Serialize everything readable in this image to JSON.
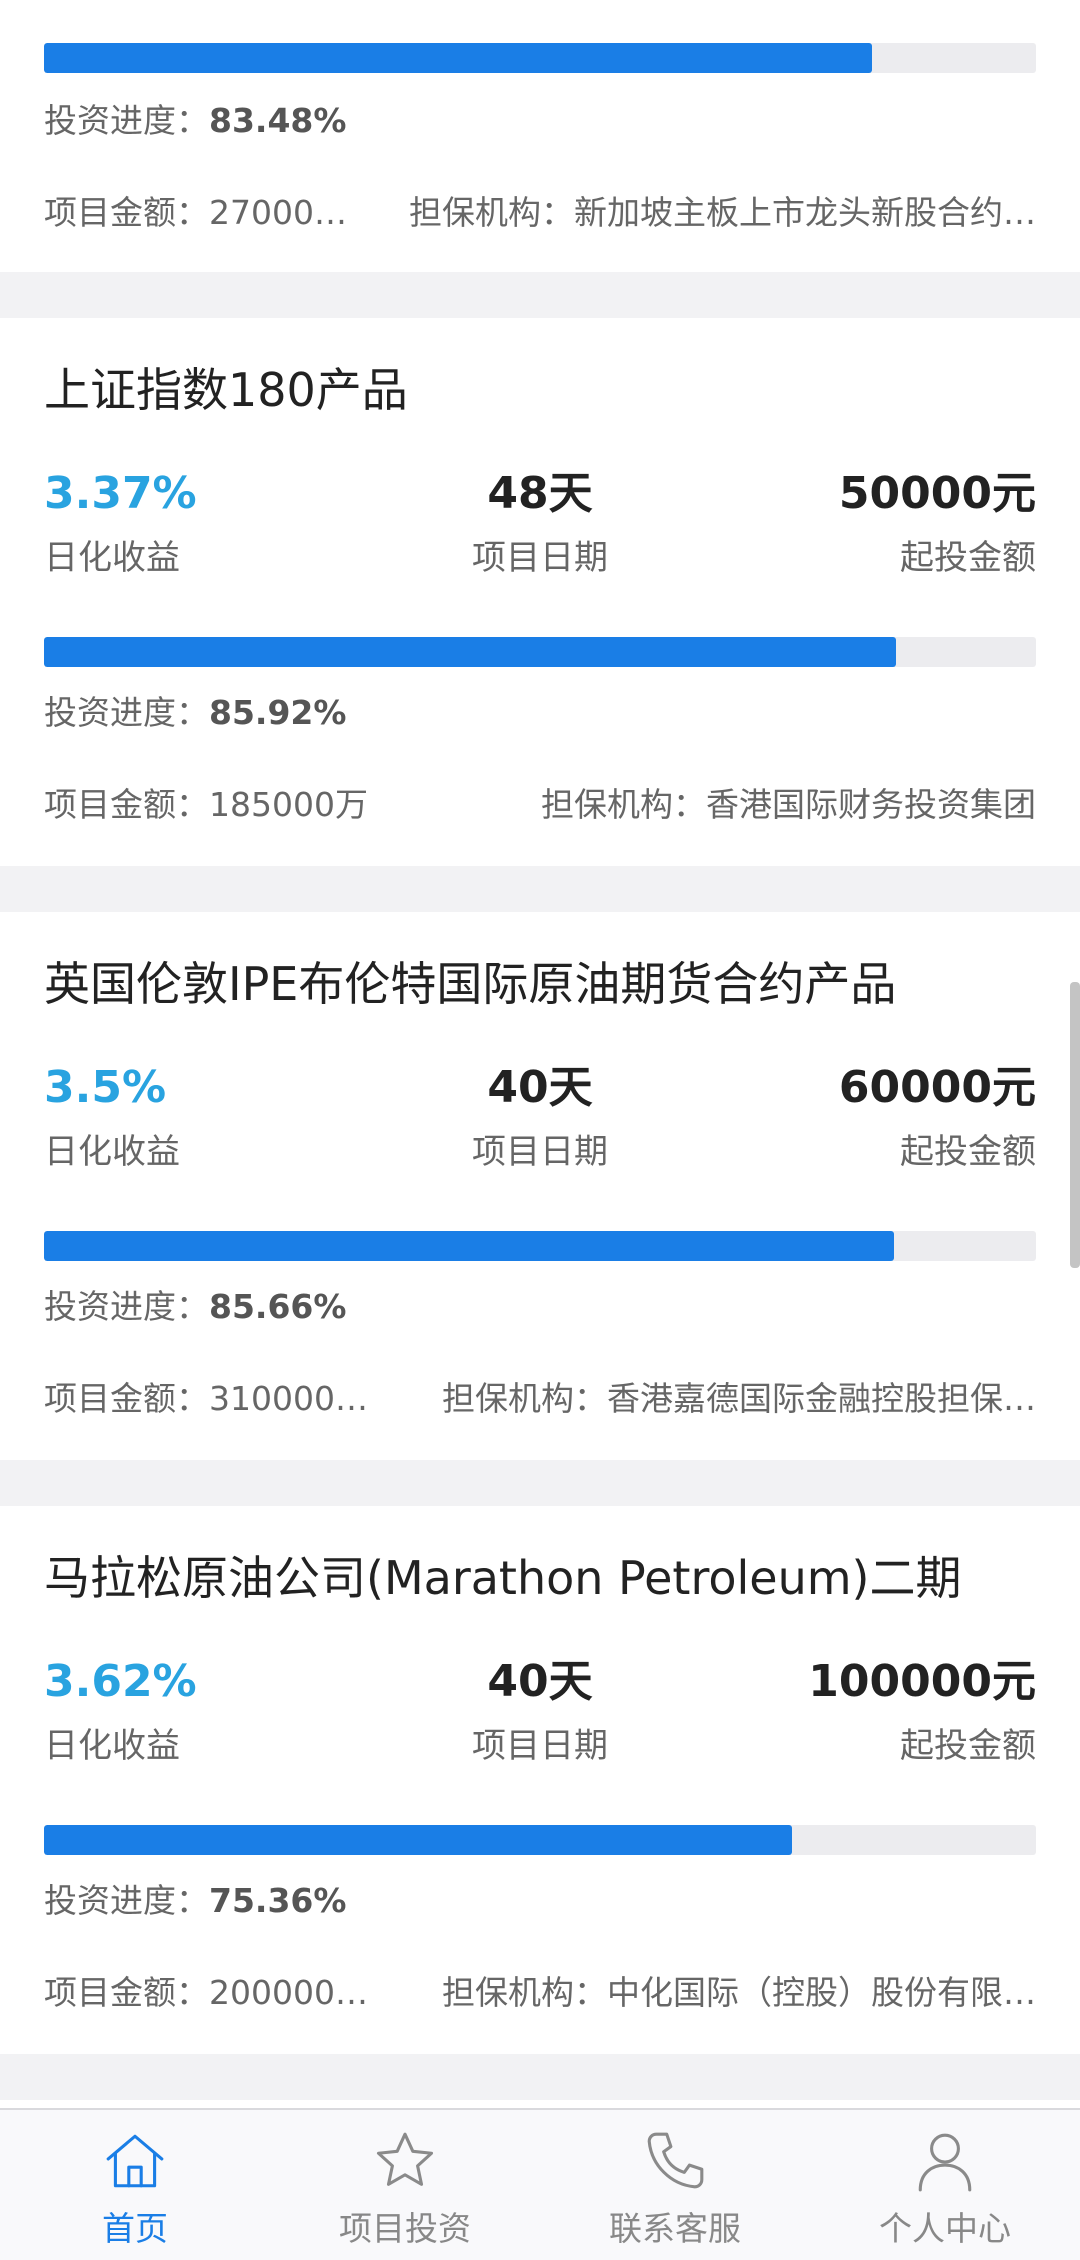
{
  "colors": {
    "accent": "#1a7ee6",
    "rate": "#29a3e0",
    "track": "#ececef",
    "muted": "#666666",
    "page_bg": "#f2f2f4"
  },
  "products": [
    {
      "progress_label": "投资进度：",
      "progress_value": "83.48%",
      "progress": 0.8348,
      "amount_text": "项目金额：27000…",
      "guarantor_text": "担保机构：新加坡主板上市龙头新股合约…"
    },
    {
      "title": "上证指数180产品",
      "rate": "3.37%",
      "rate_label": "日化收益",
      "days": "48天",
      "days_label": "项目日期",
      "min_invest": "50000元",
      "min_invest_label": "起投金额",
      "progress_label": "投资进度：",
      "progress_value": "85.92%",
      "progress": 0.8592,
      "amount_text": "项目金额：185000万",
      "guarantor_text": "担保机构：香港国际财务投资集团"
    },
    {
      "title": "英国伦敦IPE布伦特国际原油期货合约产品",
      "rate": "3.5%",
      "rate_label": "日化收益",
      "days": "40天",
      "days_label": "项目日期",
      "min_invest": "60000元",
      "min_invest_label": "起投金额",
      "progress_label": "投资进度：",
      "progress_value": "85.66%",
      "progress": 0.8566,
      "amount_text": "项目金额：310000…",
      "guarantor_text": "担保机构：香港嘉德国际金融控股担保…"
    },
    {
      "title": "马拉松原油公司(Marathon Petroleum)二期",
      "rate": "3.62%",
      "rate_label": "日化收益",
      "days": "40天",
      "days_label": "项目日期",
      "min_invest": "100000元",
      "min_invest_label": "起投金额",
      "progress_label": "投资进度：",
      "progress_value": "75.36%",
      "progress": 0.7536,
      "amount_text": "项目金额：200000…",
      "guarantor_text": "担保机构：中化国际（控股）股份有限…"
    }
  ],
  "tabbar": {
    "tabs": [
      {
        "label": "首页",
        "icon": "home-icon",
        "active": true
      },
      {
        "label": "项目投资",
        "icon": "star-icon",
        "active": false
      },
      {
        "label": "联系客服",
        "icon": "phone-icon",
        "active": false
      },
      {
        "label": "个人中心",
        "icon": "person-icon",
        "active": false
      }
    ]
  }
}
